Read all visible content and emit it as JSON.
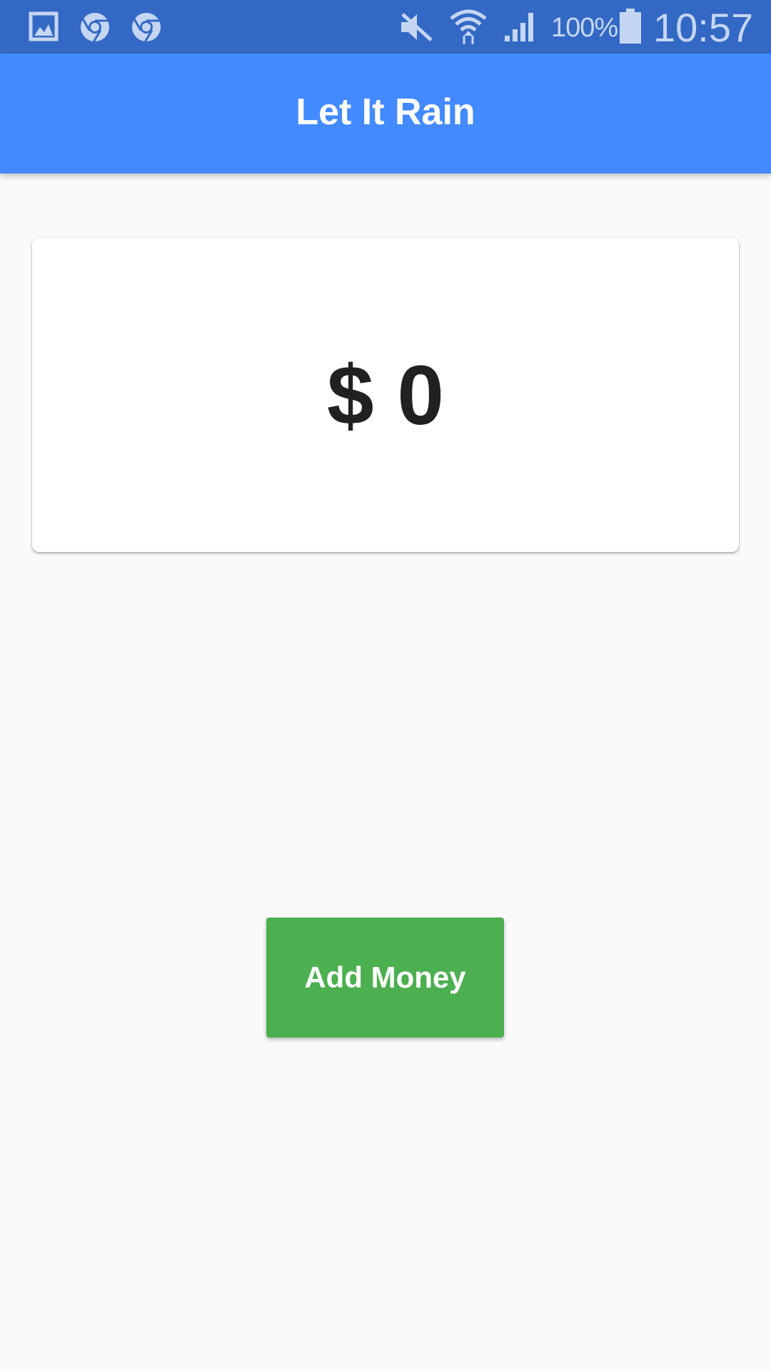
{
  "status_bar": {
    "left_icons": [
      "gallery-icon",
      "chrome-icon",
      "chrome-icon"
    ],
    "right_icons": [
      "mute-icon",
      "wifi-icon",
      "signal-icon",
      "battery-icon"
    ],
    "battery_percent": "100%",
    "time": "10:57"
  },
  "app_bar": {
    "title": "Let It Rain",
    "color": "#448aff"
  },
  "balance": {
    "amount_text": "$ 0"
  },
  "actions": {
    "add_money_label": "Add Money",
    "add_money_color": "#4caf50"
  },
  "colors": {
    "status_bar": "#3369c4",
    "background": "#fafafa"
  }
}
